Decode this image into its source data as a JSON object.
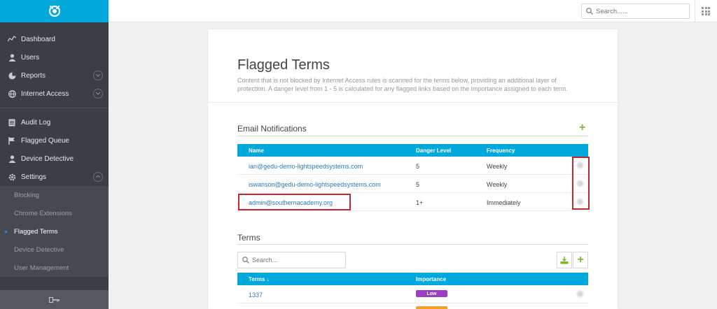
{
  "sidebar": {
    "items": [
      {
        "label": "Dashboard",
        "icon": "chart-line-icon"
      },
      {
        "label": "Users",
        "icon": "user-icon"
      },
      {
        "label": "Reports",
        "icon": "pie-chart-icon"
      },
      {
        "label": "Internet Access",
        "icon": "globe-icon"
      },
      {
        "label": "Audit Log",
        "icon": "document-icon"
      },
      {
        "label": "Flagged Queue",
        "icon": "flag-icon"
      },
      {
        "label": "Device Detective",
        "icon": "user-icon"
      },
      {
        "label": "Settings",
        "icon": "gear-icon"
      }
    ],
    "settings_sub": [
      {
        "label": "Blocking"
      },
      {
        "label": "Chrome Extensions"
      },
      {
        "label": "Flagged Terms"
      },
      {
        "label": "Device Detective"
      },
      {
        "label": "User Management"
      }
    ],
    "active_sub": "Flagged Terms"
  },
  "topbar": {
    "search_placeholder": "Search......"
  },
  "page": {
    "title": "Flagged Terms",
    "description": "Content that is not blocked by Internet Access rules is scanned for the terms below, providing an additional layer of protection. A danger level from 1 - 5 is calculated for any flagged links based on the importance assigned to each term."
  },
  "email_section": {
    "title": "Email Notifications",
    "add_label": "+",
    "columns": [
      "Name",
      "Danger Level",
      "Frequency"
    ],
    "rows": [
      {
        "name": "ian@gedu-demo-lightspeedsystems.com",
        "danger": "5",
        "frequency": "Weekly"
      },
      {
        "name": "iswanson@gedu-demo-lightspeedsystems.com",
        "danger": "5",
        "frequency": "Weekly"
      },
      {
        "name": "admin@southernacademy.org",
        "danger": "1+",
        "frequency": "Immediately"
      }
    ]
  },
  "terms_section": {
    "title": "Terms",
    "search_placeholder": "Search...",
    "add_label": "+",
    "columns": [
      "Terms ↓",
      "Importance"
    ],
    "rows": [
      {
        "term": "1337",
        "importance": "Low"
      }
    ]
  },
  "colors": {
    "accent": "#00a8dc",
    "sidebar": "#3b3f45",
    "highlight": "#c0282d",
    "add_green": "#7ab929",
    "badge_low": "#9b3fc2",
    "badge_next": "#f0a030"
  }
}
